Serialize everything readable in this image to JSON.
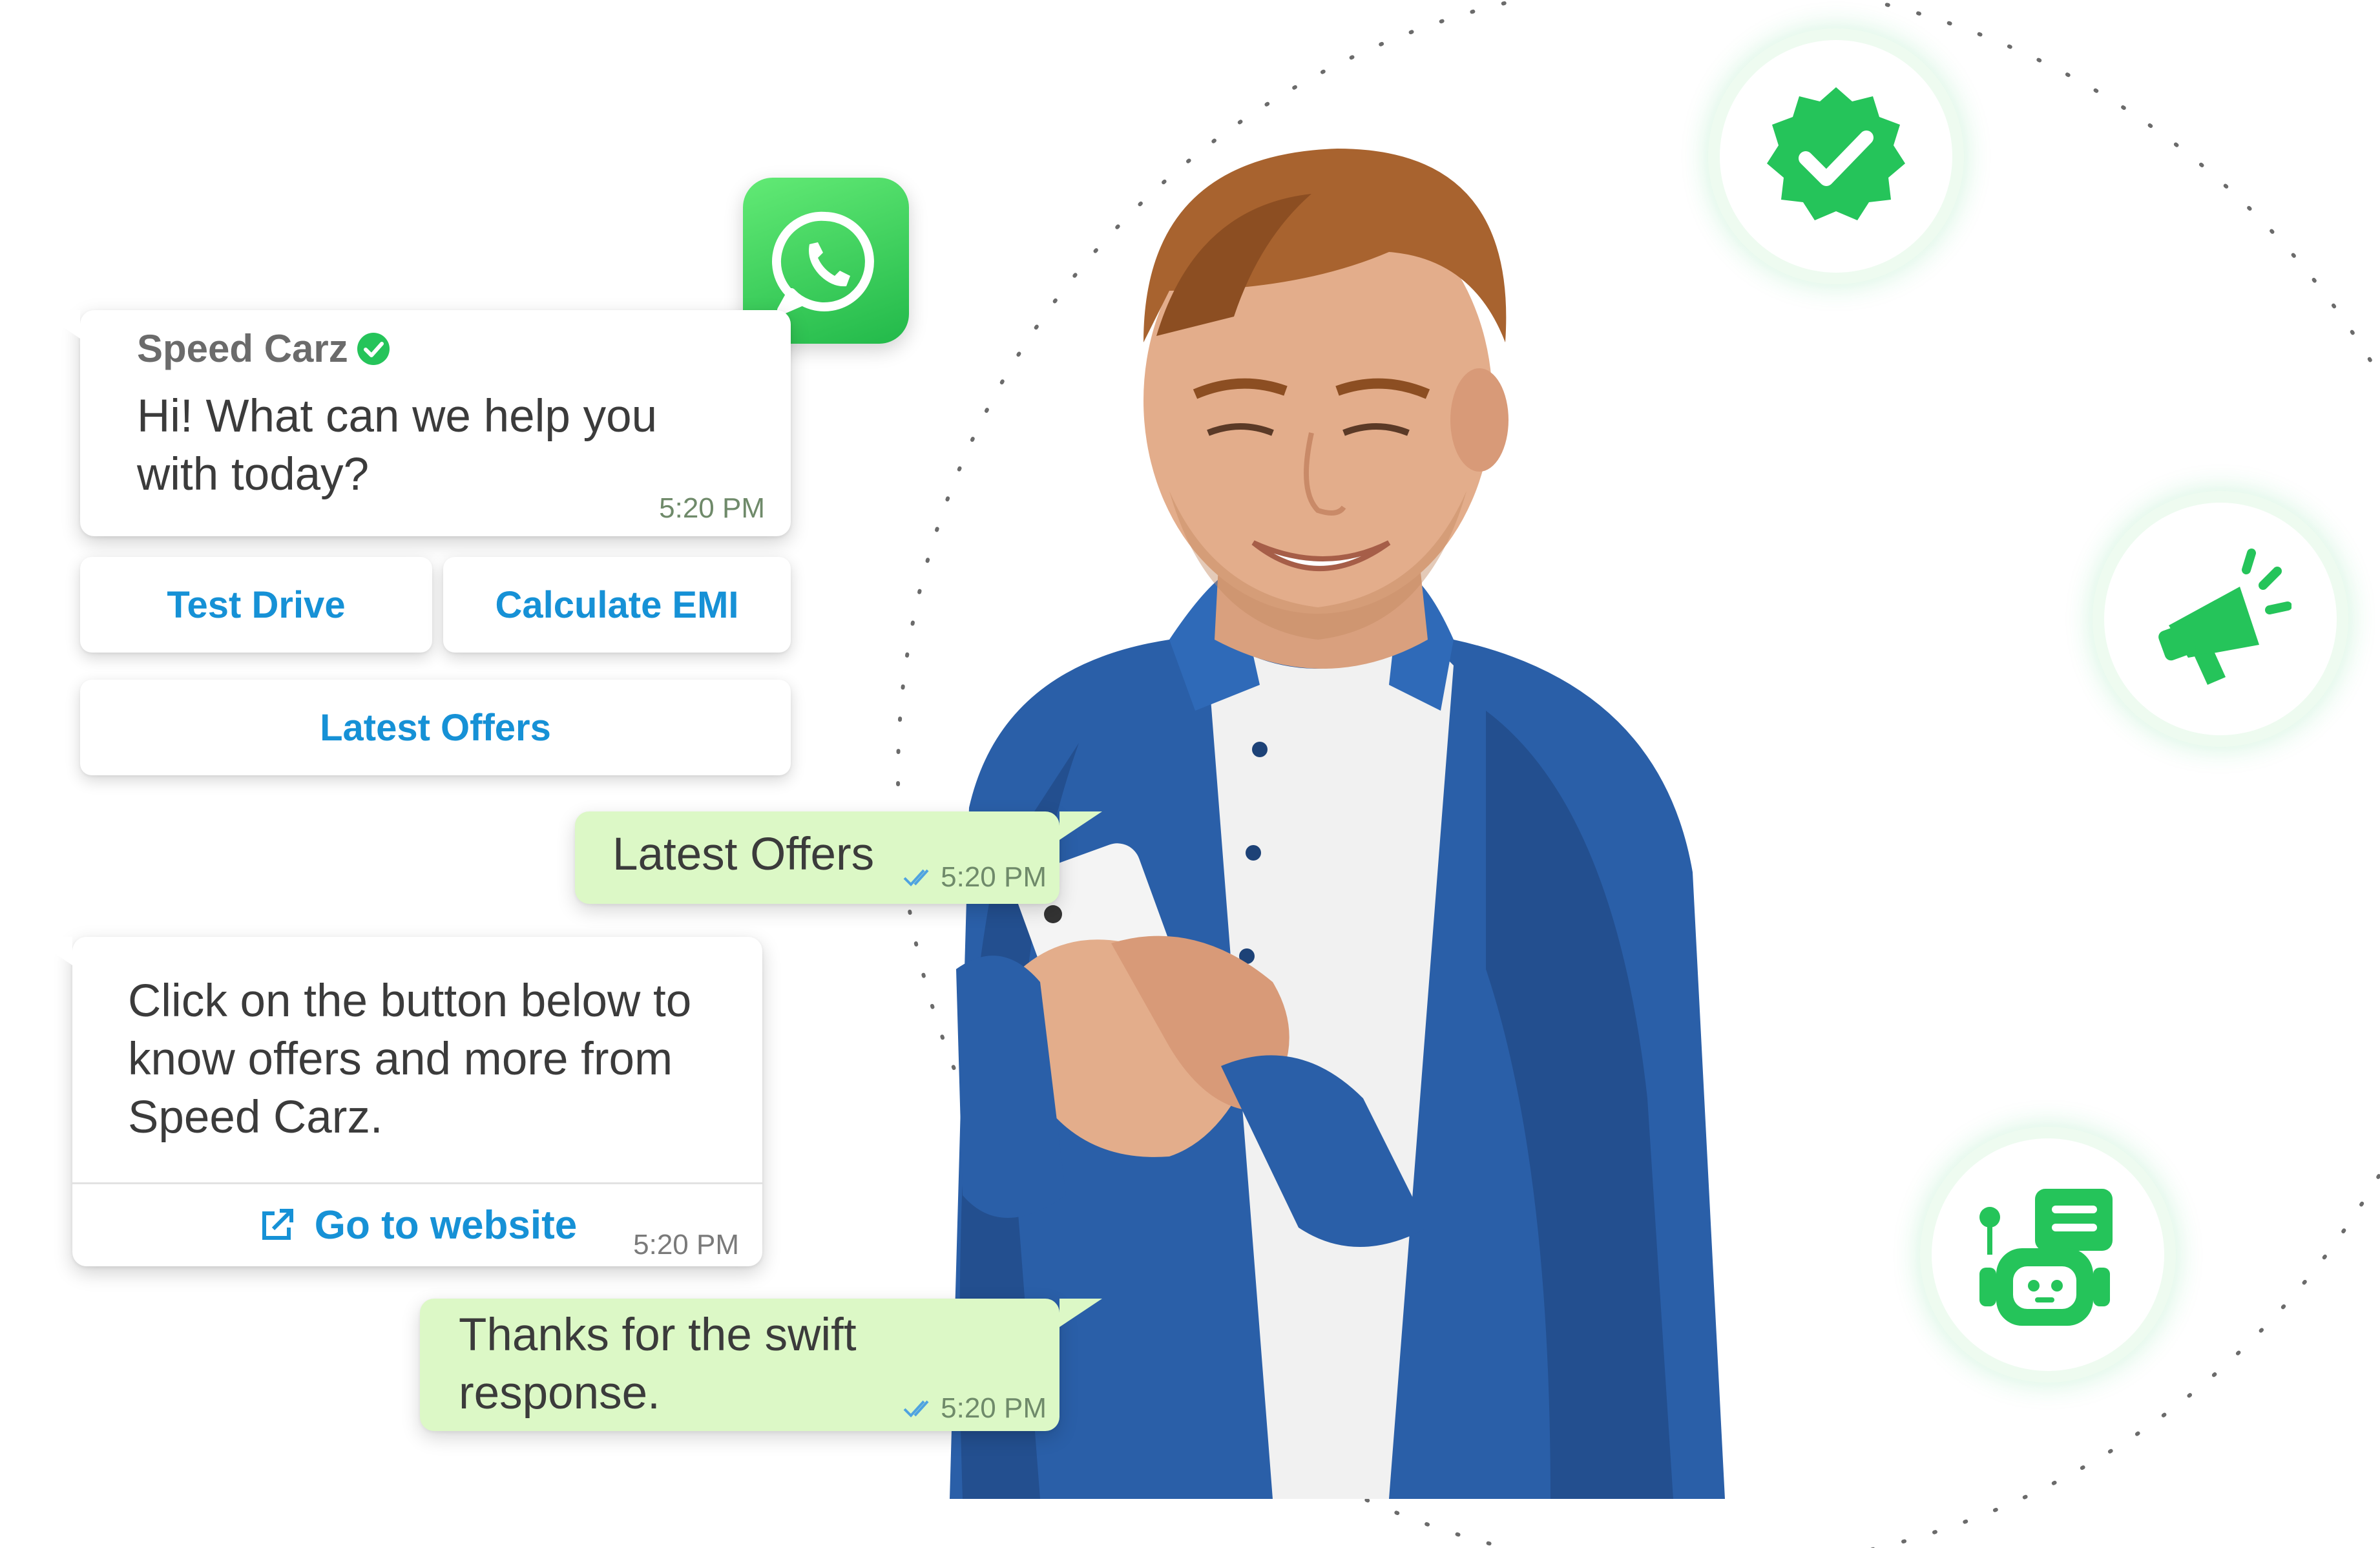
{
  "chat": {
    "business_name": "Speed Carz",
    "greeting": {
      "line1": "Hi! What can we help you",
      "line2": "with today?",
      "time": "5:20 PM"
    },
    "quick_replies": [
      "Test Drive",
      "Calculate EMI",
      "Latest Offers"
    ],
    "user_reply_1": {
      "text": "Latest Offers",
      "time": "5:20 PM"
    },
    "offer_message": {
      "line1": "Click on the button below to",
      "line2": "know offers and more from",
      "line3": "Speed Carz.",
      "cta_label": "Go to website",
      "time": "5:20 PM"
    },
    "user_reply_2": {
      "line1": "Thanks for the swift",
      "line2": "response.",
      "time": "5:20 PM"
    }
  },
  "icons": {
    "app_logo": "whatsapp-logo-icon",
    "verified": "verified-badge-icon",
    "megaphone": "megaphone-icon",
    "chatbot": "chatbot-icon",
    "link": "external-link-icon",
    "read_receipt": "double-check-icon"
  },
  "colors": {
    "brand_green": "#25c45a",
    "bubble_out": "#dcf8c6",
    "link_blue": "#1691d6",
    "read_tick_blue": "#4fa3e0",
    "shirt_blue": "#2a5fa8"
  }
}
